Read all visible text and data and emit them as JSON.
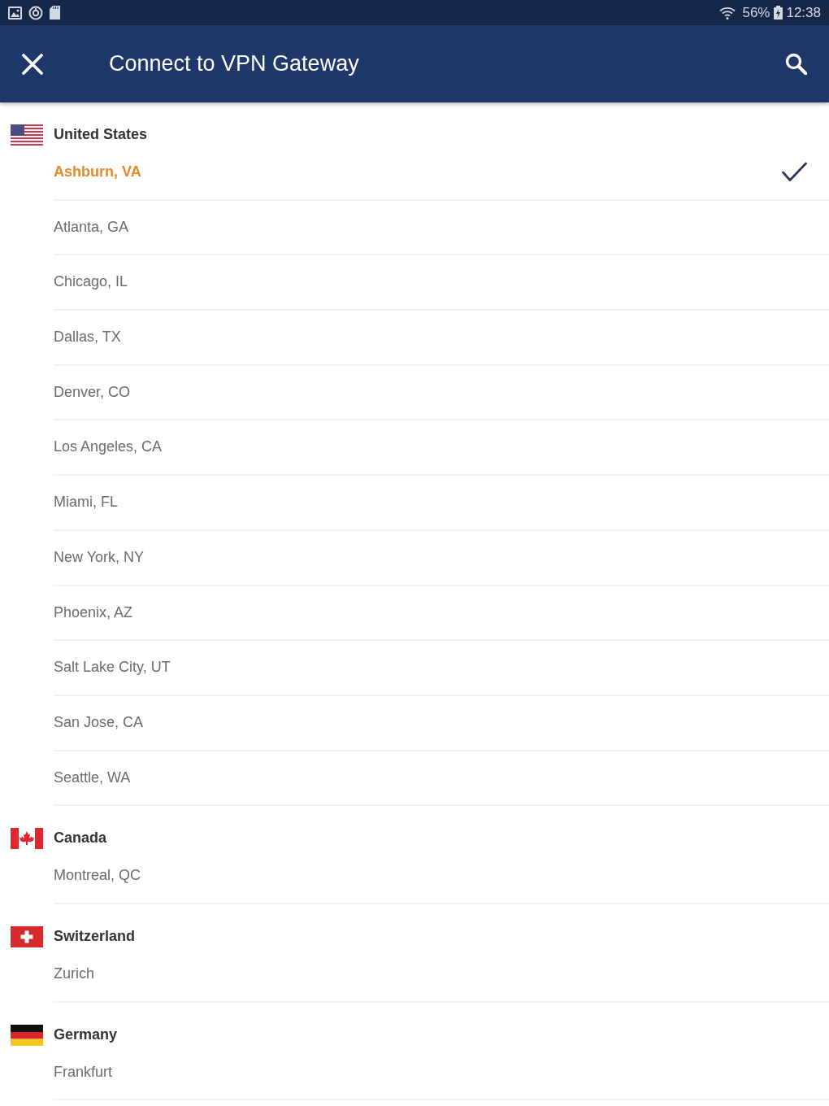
{
  "status_bar": {
    "battery": "56%",
    "time": "12:38"
  },
  "app_bar": {
    "title": "Connect to VPN Gateway"
  },
  "countries": [
    {
      "name": "United States",
      "kind": "us",
      "cities": [
        {
          "name": "Ashburn, VA",
          "selected": true
        },
        {
          "name": "Atlanta, GA",
          "selected": false
        },
        {
          "name": "Chicago, IL",
          "selected": false
        },
        {
          "name": "Dallas, TX",
          "selected": false
        },
        {
          "name": "Denver, CO",
          "selected": false
        },
        {
          "name": "Los Angeles, CA",
          "selected": false
        },
        {
          "name": "Miami, FL",
          "selected": false
        },
        {
          "name": "New York, NY",
          "selected": false
        },
        {
          "name": "Phoenix, AZ",
          "selected": false
        },
        {
          "name": "Salt Lake City, UT",
          "selected": false
        },
        {
          "name": "San Jose, CA",
          "selected": false
        },
        {
          "name": "Seattle, WA",
          "selected": false
        }
      ]
    },
    {
      "name": "Canada",
      "kind": "ca",
      "cities": [
        {
          "name": "Montreal, QC",
          "selected": false
        }
      ]
    },
    {
      "name": "Switzerland",
      "kind": "ch",
      "cities": [
        {
          "name": "Zurich",
          "selected": false
        }
      ]
    },
    {
      "name": "Germany",
      "kind": "de",
      "cities": [
        {
          "name": "Frankfurt",
          "selected": false
        }
      ]
    }
  ]
}
